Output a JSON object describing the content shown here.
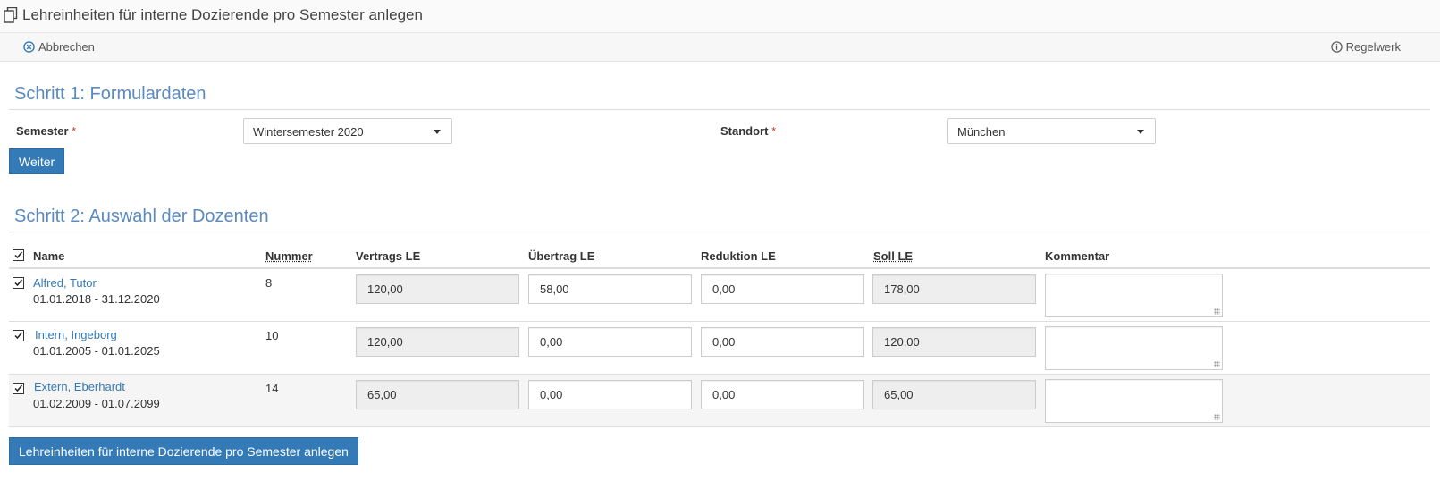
{
  "page": {
    "title": "Lehreinheiten für interne Dozierende pro Semester anlegen",
    "title_icon": "copy-icon"
  },
  "toolbar": {
    "cancel_label": "Abbrechen",
    "cancel_icon": "cancel-circle-icon",
    "rules_label": "Regelwerk",
    "rules_icon": "info-circle-icon"
  },
  "step1": {
    "title": "Schritt 1: Formulardaten",
    "semester_label": "Semester",
    "semester_value": "Wintersemester 2020",
    "location_label": "Standort",
    "location_value": "München",
    "required_marker": "*",
    "next_button": "Weiter"
  },
  "step2": {
    "title": "Schritt 2: Auswahl der Dozenten",
    "columns": {
      "name": "Name",
      "number": "Nummer",
      "contract": "Vertrags LE",
      "carryover": "Übertrag LE",
      "reduction": "Reduktion LE",
      "target": "Soll LE",
      "comment": "Kommentar"
    },
    "rows": [
      {
        "checked": true,
        "name": "Alfred, Tutor",
        "dates": "01.01.2018 - 31.12.2020",
        "number": "8",
        "contract": "120,00",
        "carryover": "58,00",
        "reduction": "0,00",
        "target": "178,00",
        "comment": ""
      },
      {
        "checked": true,
        "name": "Intern, Ingeborg",
        "dates": "01.01.2005 - 01.01.2025",
        "number": "10",
        "contract": "120,00",
        "carryover": "0,00",
        "reduction": "0,00",
        "target": "120,00",
        "comment": ""
      },
      {
        "checked": true,
        "name": "Extern, Eberhardt",
        "dates": "01.02.2009 - 01.07.2099",
        "number": "14",
        "contract": "65,00",
        "carryover": "0,00",
        "reduction": "0,00",
        "target": "65,00",
        "comment": ""
      }
    ],
    "submit_button": "Lehreinheiten für interne Dozierende pro Semester anlegen"
  },
  "colors": {
    "primary": "#337ab7",
    "heading": "#5a8ac0",
    "required": "#c0392b"
  }
}
